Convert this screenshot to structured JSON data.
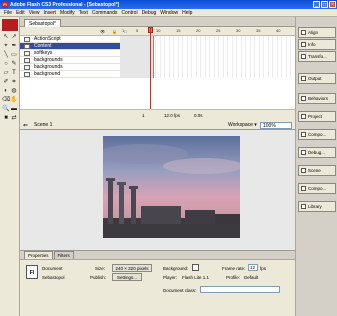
{
  "window": {
    "title": "Adobe Flash CS3 Professional - [Sebastopol*]",
    "logo_text": "Fl",
    "minimize": "_",
    "maximize": "□",
    "close": "×"
  },
  "menu": [
    "File",
    "Edit",
    "View",
    "Insert",
    "Modify",
    "Text",
    "Commands",
    "Control",
    "Debug",
    "Window",
    "Help"
  ],
  "document_tab": "Sebastopol*",
  "tools": [
    "↖",
    "↗",
    "⌖",
    "✒",
    "╲",
    "▭",
    "○",
    "✎",
    "▱",
    "T",
    "✐",
    "⌗",
    "◐",
    "◍",
    "⌫",
    "✋",
    "🔍",
    "▬",
    "■",
    "⇄"
  ],
  "timeline": {
    "header_icons": "👁 🔒 □",
    "ruler_ticks": [
      "1",
      "5",
      "10",
      "15",
      "20",
      "25",
      "30",
      "35",
      "40",
      "45",
      "50",
      "55",
      "60"
    ],
    "layers": [
      {
        "name": "ActionScript",
        "selected": false
      },
      {
        "name": "Content",
        "selected": true
      },
      {
        "name": "softkeys",
        "selected": false
      },
      {
        "name": "backgrounds",
        "selected": false
      },
      {
        "name": "backgrounds",
        "selected": false
      },
      {
        "name": "background",
        "selected": false
      }
    ],
    "footer": {
      "frame": "1",
      "fps": "12.0 fps",
      "time": "0.0s"
    }
  },
  "editbar": {
    "scene": "Scene 1",
    "back_icon": "⇐",
    "workspace": "Workspace ▾",
    "zoom": "100%"
  },
  "right_panels": [
    "Align",
    "Info",
    "Transfo...",
    "Output",
    "Behaviors",
    "Project",
    "Compo...",
    "Debug...",
    "Scene",
    "Compo...",
    "Library"
  ],
  "properties": {
    "tabs": [
      "Properties",
      "Filters"
    ],
    "doc_icon": "Fl",
    "doc_type": "Document",
    "doc_name": "Sebastopol",
    "size_label": "Size:",
    "size_value": "240 × 320 pixels",
    "publish_label": "Publish:",
    "settings_btn": "Settings...",
    "bg_label": "Background:",
    "framerate_label": "Frame rate:",
    "framerate_value": "12",
    "fps_unit": "fps",
    "player_label": "Player:",
    "player_value": "Flash Lite 1.1",
    "profile_label": "Profile:",
    "profile_value": "Default",
    "docclass_label": "Document class:"
  },
  "colors": {
    "titlebar": "#0a4ed8",
    "selected_layer": "#334d99",
    "playhead": "#ee2211"
  }
}
